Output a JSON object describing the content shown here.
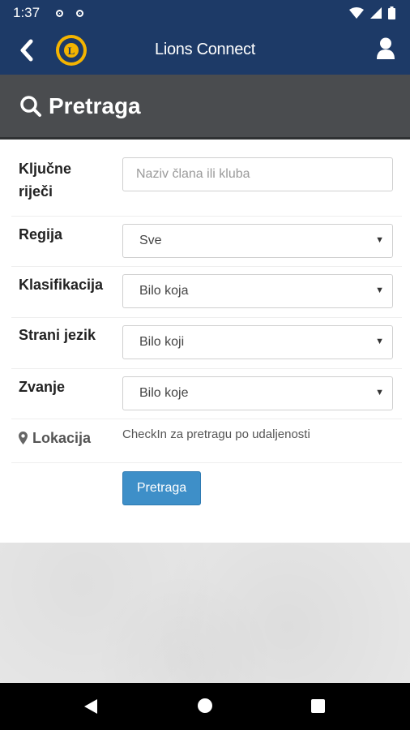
{
  "status_bar": {
    "time": "1:37",
    "icons": [
      "notification-icon",
      "notification-icon",
      "wifi-icon",
      "signal-icon",
      "battery-icon"
    ]
  },
  "app_bar": {
    "title": "Lions Connect",
    "back_icon": "chevron-left-icon",
    "profile_icon": "user-icon",
    "logo": "lions-logo",
    "logo_letter": "L",
    "colors": {
      "background": "#1d3a67",
      "logo_gold": "#f4b400"
    }
  },
  "page_header": {
    "title": "Pretraga",
    "icon": "search-icon",
    "background": "#4a4c4f"
  },
  "form": {
    "keywords": {
      "label": "Ključne riječi",
      "placeholder": "Naziv člana ili kluba",
      "value": ""
    },
    "region": {
      "label": "Regija",
      "selected": "Sve"
    },
    "classification": {
      "label": "Klasifikacija",
      "selected": "Bilo koja"
    },
    "language": {
      "label": "Strani jezik",
      "selected": "Bilo koji"
    },
    "title": {
      "label": "Zvanje",
      "selected": "Bilo koje"
    },
    "location": {
      "label": "Lokacija",
      "icon": "map-marker-icon",
      "text": "CheckIn za pretragu po udaljenosti"
    },
    "submit_label": "Pretraga",
    "submit_color": "#3e8fc8"
  },
  "nav_bar": {
    "icons": [
      "back-triangle-icon",
      "home-circle-icon",
      "recents-square-icon"
    ]
  }
}
